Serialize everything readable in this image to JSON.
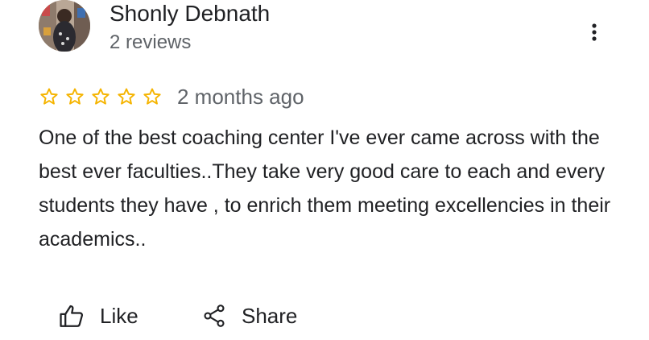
{
  "review": {
    "author_name": "Shonly Debnath",
    "review_count": "2 reviews",
    "rating": 0,
    "rating_max": 5,
    "date": "2 months ago",
    "text": "One of the best coaching center I've ever came across with the best ever faculties..They take very good care to each and every students they have , to enrich them meeting excellencies in their academics.."
  },
  "actions": {
    "like_label": "Like",
    "share_label": "Share"
  },
  "icons": {
    "more": "more-vert-icon",
    "star": "star-outline-icon",
    "like": "thumb-up-outline-icon",
    "share": "share-icon"
  },
  "colors": {
    "star": "#f5b400",
    "text_primary": "#202124",
    "text_secondary": "#5f6368",
    "icon": "#202124"
  }
}
